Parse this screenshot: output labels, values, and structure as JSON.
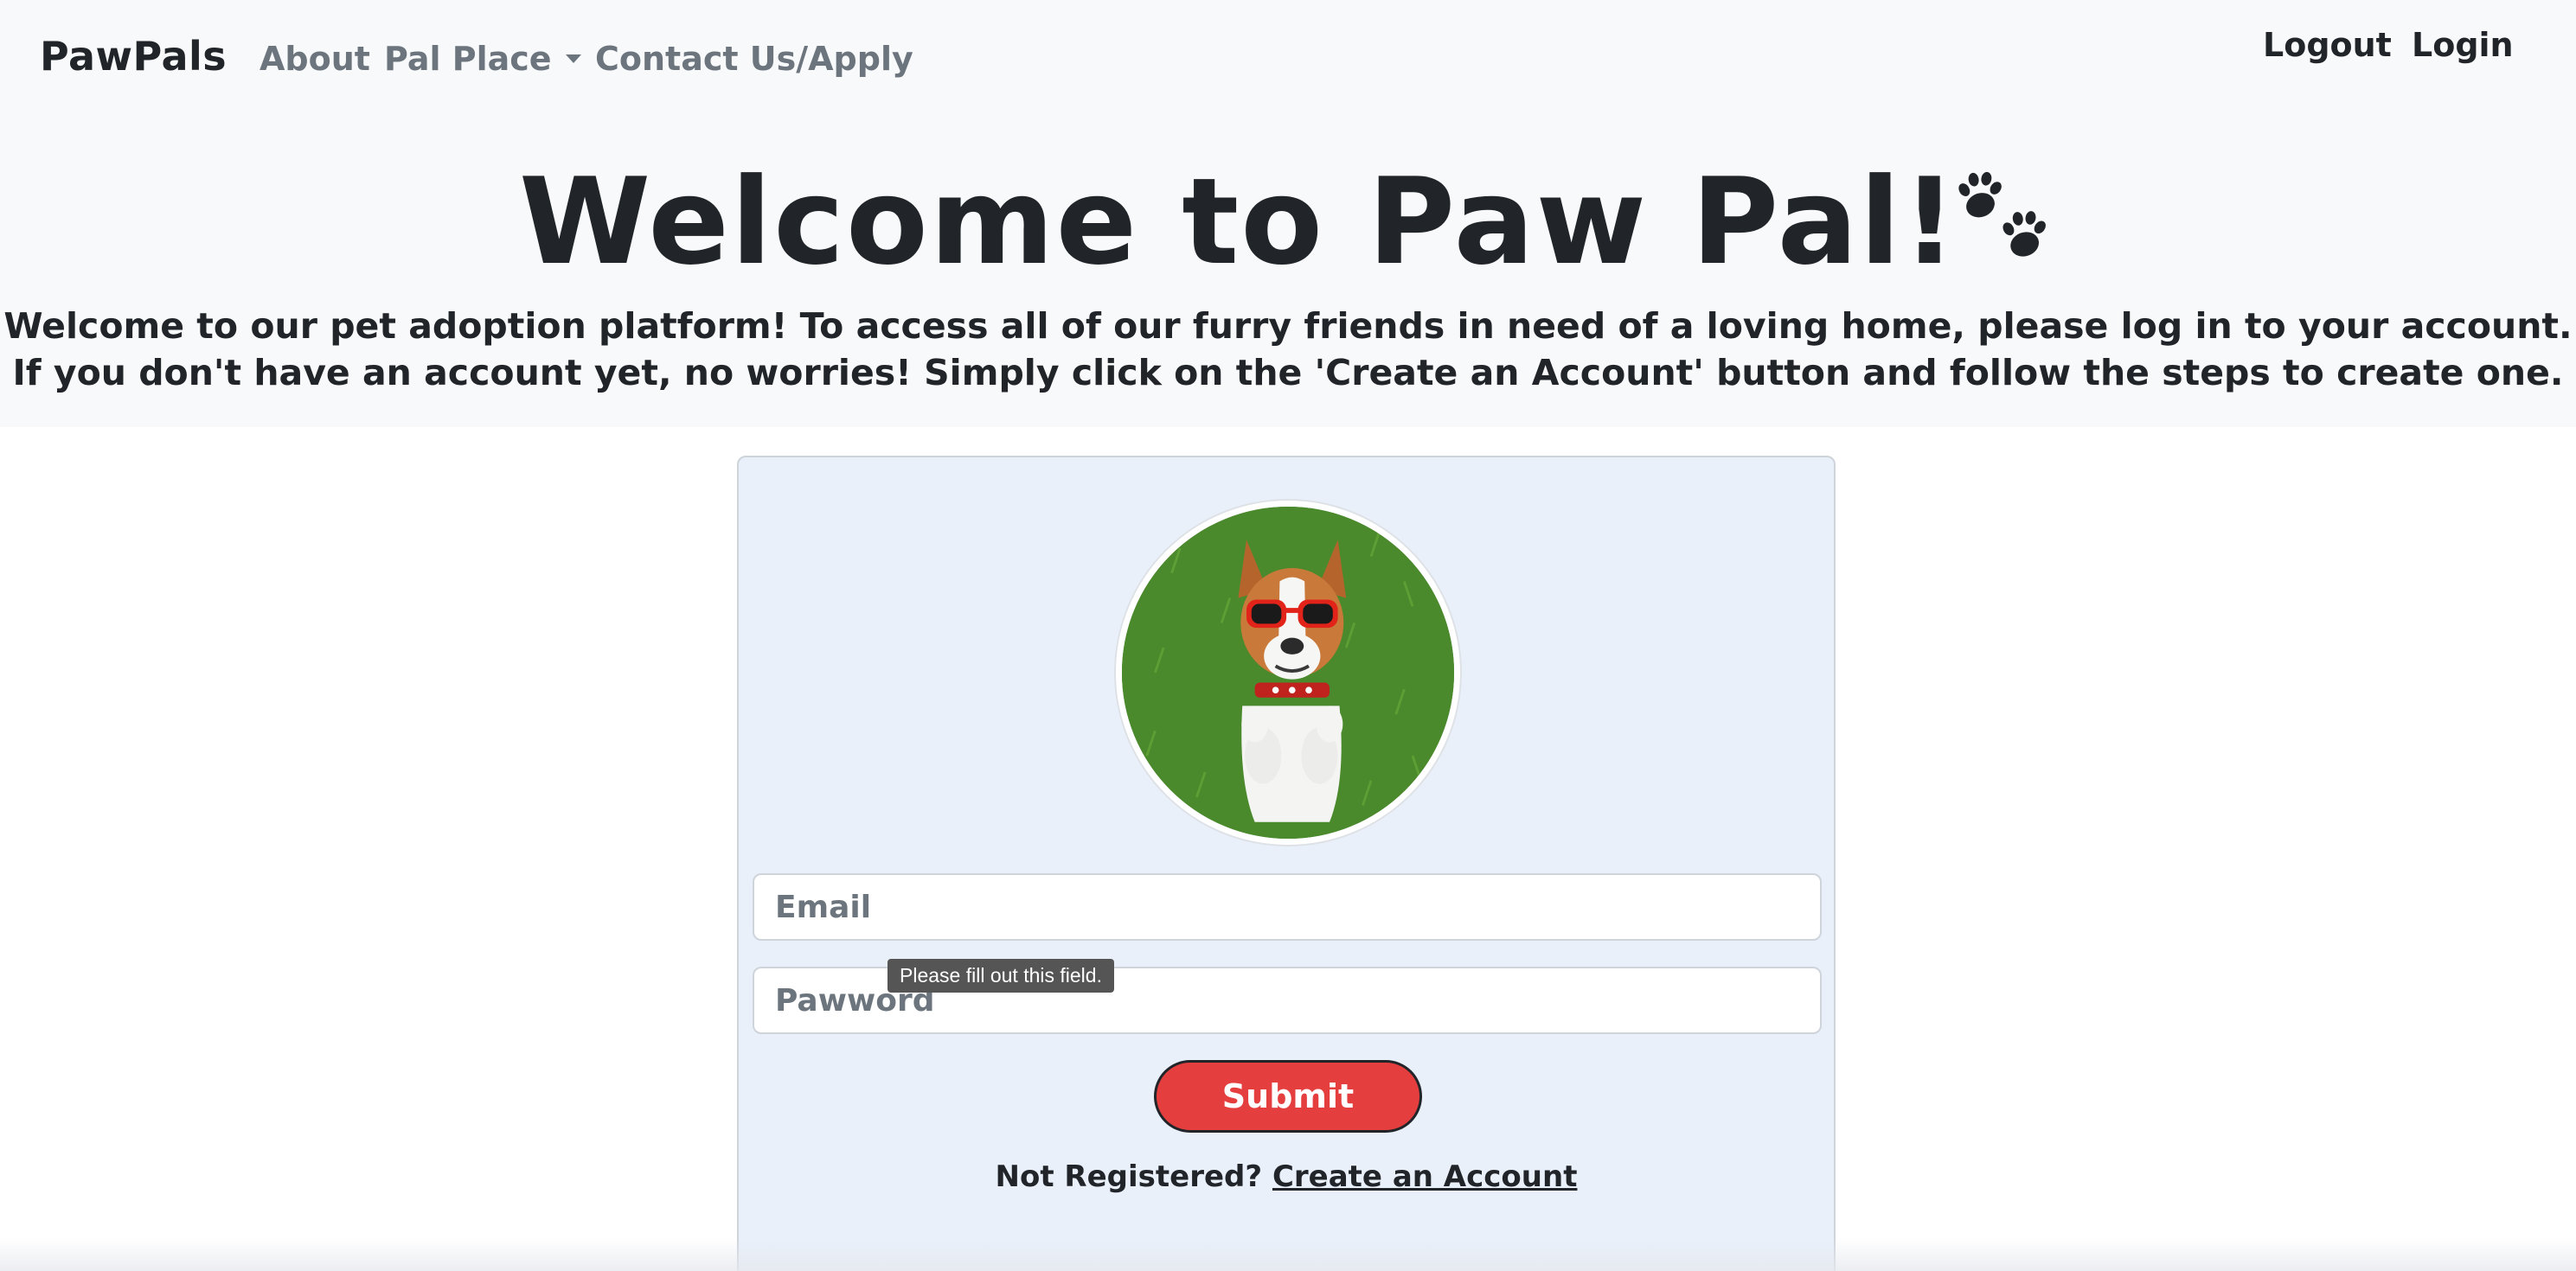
{
  "navbar": {
    "brand": "PawPals",
    "links": [
      {
        "label": "About"
      },
      {
        "label": "Pal Place",
        "dropdown": true
      },
      {
        "label": "Contact Us/Apply"
      }
    ],
    "right_links": [
      {
        "label": "Logout"
      },
      {
        "label": "Login"
      }
    ]
  },
  "hero": {
    "title": "Welcome to Paw Pal!",
    "title_icon": "paw-prints-icon",
    "subtitle_line1": "Welcome to our pet adoption platform! To access all of our furry friends in need of a loving home, please log in to your account.",
    "subtitle_line2": "If you don't have an account yet, no worries! Simply click on the 'Create an Account' button and follow the steps to create one."
  },
  "login_form": {
    "avatar_icon": "dog-with-sunglasses-photo",
    "email_placeholder": "Email",
    "password_placeholder": "Pawword",
    "validation_tooltip": "Please fill out this field.",
    "submit_label": "Submit",
    "register_prompt": "Not Registered?",
    "register_link": "Create an Account"
  },
  "colors": {
    "page_header_bg": "#f8f9fa",
    "card_bg": "#e9f0fa",
    "submit_bg": "#e53e3e",
    "text_dark": "#212529",
    "nav_muted": "#6c757d"
  }
}
